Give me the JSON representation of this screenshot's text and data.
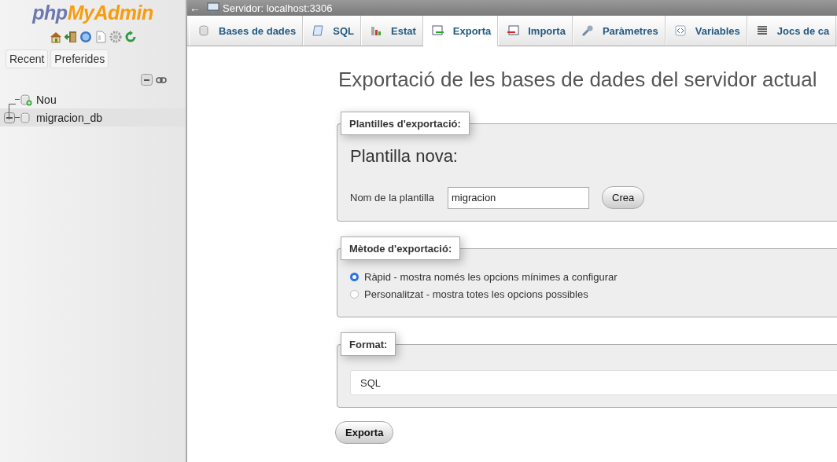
{
  "sidebar": {
    "logo": {
      "prefix": "php",
      "name": "MyAdmin"
    },
    "buttons": [
      "Recent",
      "Preferides"
    ],
    "tree": [
      {
        "label": "Nou",
        "selected": false
      },
      {
        "label": "migracion_db",
        "selected": true
      }
    ]
  },
  "topbar": {
    "back": "←",
    "server": "Servidor: localhost:3306"
  },
  "tabs": [
    {
      "label": "Bases de dades",
      "selected": false
    },
    {
      "label": "SQL",
      "selected": false
    },
    {
      "label": "Estat",
      "selected": false
    },
    {
      "label": "Exporta",
      "selected": true
    },
    {
      "label": "Importa",
      "selected": false
    },
    {
      "label": "Paràmetres",
      "selected": false
    },
    {
      "label": "Variables",
      "selected": false
    },
    {
      "label": "Jocs de ca",
      "selected": false
    }
  ],
  "title": "Exportació de les bases de dades del servidor actual",
  "templates": {
    "legend": "Plantilles d'exportació:",
    "heading": "Plantilla nova:",
    "field_label": "Nom de la plantilla",
    "value": "migracion",
    "button": "Crea"
  },
  "method": {
    "legend": "Mètode d'exportació:",
    "options": [
      {
        "label": "Ràpid - mostra només les opcions mínimes a configurar",
        "selected": true
      },
      {
        "label": "Personalitzat - mostra totes les opcions possibles",
        "selected": false
      }
    ]
  },
  "format": {
    "legend": "Format:",
    "value": "SQL"
  },
  "export_button": "Exporta"
}
